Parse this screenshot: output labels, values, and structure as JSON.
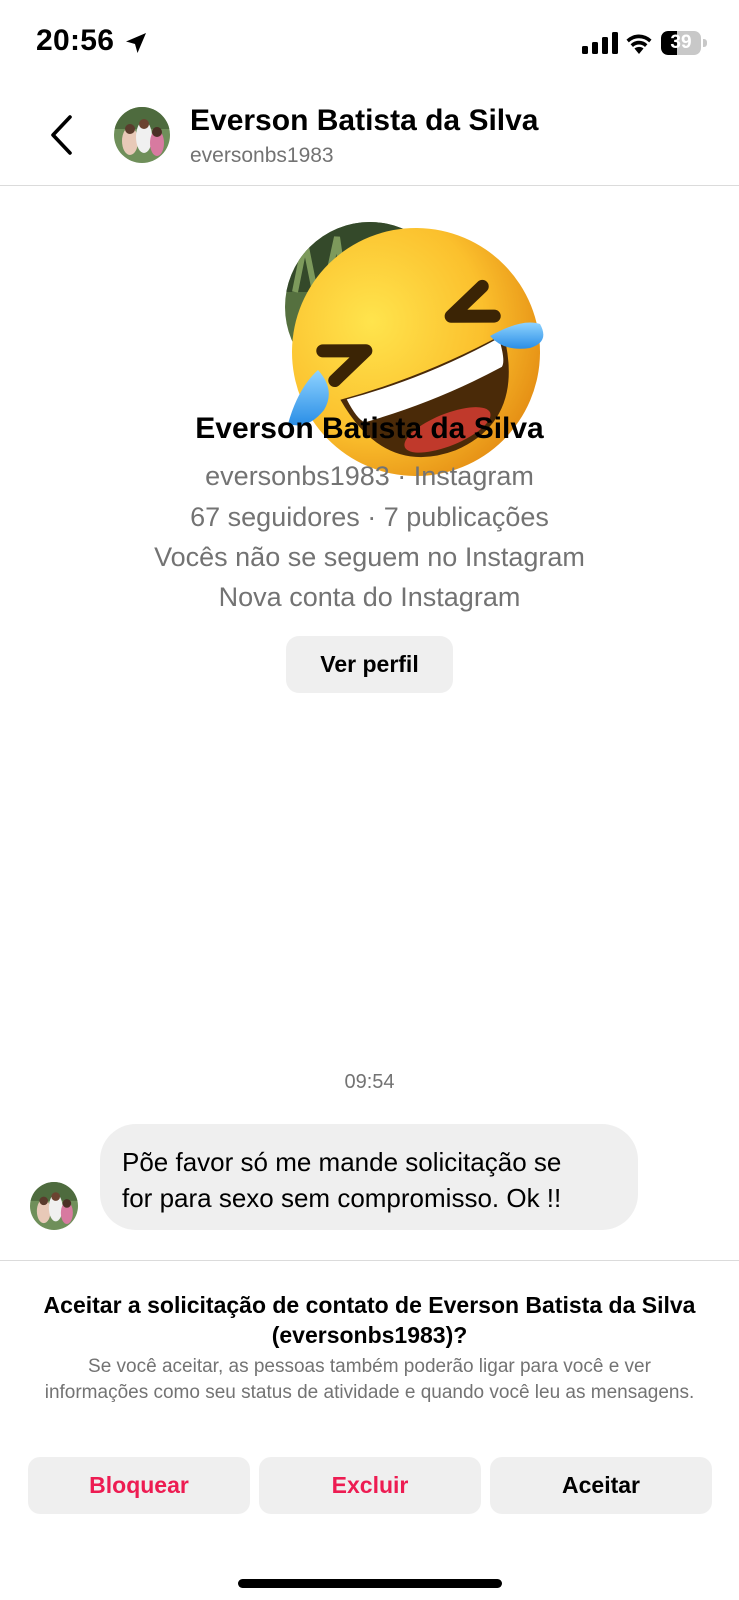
{
  "status_bar": {
    "time": "20:56",
    "battery": "39",
    "battery_level": 0.39,
    "icons": [
      "location-arrow-icon",
      "cellular-signal-icon",
      "wifi-icon",
      "battery-icon"
    ]
  },
  "header": {
    "name": "Everson Batista da Silva",
    "username": "eversonbs1983",
    "back_icon": "chevron-left-icon"
  },
  "profile": {
    "name": "Everson Batista da Silva",
    "handle_line": "eversonbs1983 · Instagram",
    "stats": "67 seguidores · 7 publicações",
    "follow_status": "Vocês não se seguem no Instagram",
    "account_note": "Nova conta do Instagram",
    "view_profile_label": "Ver perfil",
    "overlay_emoji": "rolling-on-the-floor-laughing-emoji"
  },
  "conversation": {
    "timestamp": "09:54",
    "messages": [
      {
        "text_line1": "Põe favor só me mande solicitação se",
        "text_line2": "for para sexo sem compromisso. Ok !!"
      }
    ]
  },
  "request": {
    "title": "Aceitar a solicitação de contato de Everson Batista da Silva (eversonbs1983)?",
    "description": "Se você aceitar, as pessoas também poderão ligar para você e ver informações como seu status de atividade e quando você leu as mensagens.",
    "block_label": "Bloquear",
    "delete_label": "Excluir",
    "accept_label": "Aceitar"
  },
  "colors": {
    "destructive": "#ed1c52",
    "secondary_text": "#737373",
    "button_bg": "#efefef",
    "bubble_bg": "#efefef"
  }
}
